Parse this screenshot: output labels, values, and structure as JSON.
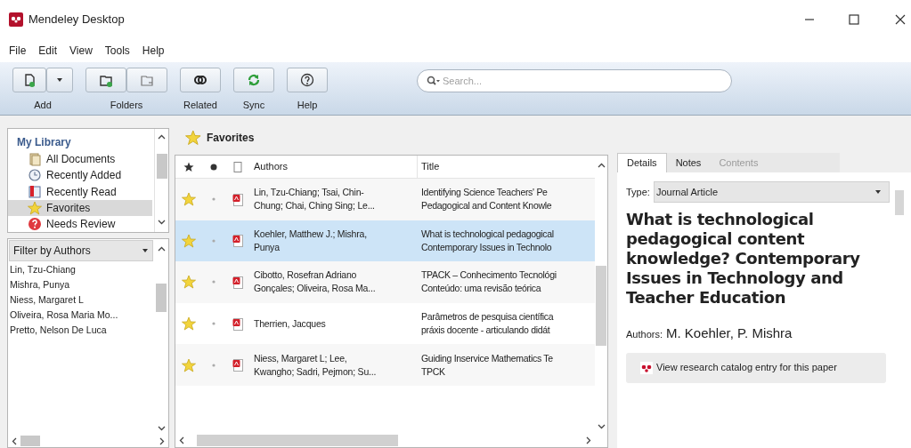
{
  "window": {
    "title": "Mendeley Desktop"
  },
  "menu": [
    "File",
    "Edit",
    "View",
    "Tools",
    "Help"
  ],
  "toolbar": [
    {
      "kind": "add",
      "label": "Add"
    },
    {
      "kind": "folders",
      "label": "Folders"
    },
    {
      "kind": "related",
      "label": "Related"
    },
    {
      "kind": "sync",
      "label": "Sync"
    },
    {
      "kind": "help",
      "label": "Help"
    }
  ],
  "search": {
    "placeholder": "Search..."
  },
  "sidebar": {
    "title": "My Library",
    "items": [
      {
        "kind": "all",
        "label": "All Documents",
        "selected": false
      },
      {
        "kind": "recent-added",
        "label": "Recently Added",
        "selected": false
      },
      {
        "kind": "recent-read",
        "label": "Recently Read",
        "selected": false
      },
      {
        "kind": "favorites",
        "label": "Favorites",
        "selected": true
      },
      {
        "kind": "review",
        "label": "Needs Review",
        "selected": false
      }
    ]
  },
  "filter": {
    "label": "Filter by Authors",
    "items": [
      "Lin, Tzu-Chiang",
      "Mishra, Punya",
      "Niess, Margaret L",
      "Oliveira, Rosa Maria Mo...",
      "Pretto, Nelson De Luca"
    ]
  },
  "list_title": "Favorites",
  "table": {
    "columns": [
      "Authors",
      "Title"
    ],
    "rows": [
      {
        "favorite": true,
        "selected": false,
        "authors": "Lin, Tzu-Chiang; Tsai, Chin-\nChung; Chai, Ching Sing; Le...",
        "title": "Identifying Science Teachers' Pe\nPedagogical and Content Knowle"
      },
      {
        "favorite": true,
        "selected": true,
        "authors": "Koehler, Matthew J.; Mishra,\nPunya",
        "title": "What is technological pedagogical\nContemporary Issues in Technolo"
      },
      {
        "favorite": true,
        "selected": false,
        "authors": "Cibotto, Rosefran Adriano\nGonçales; Oliveira, Rosa Ma...",
        "title": "TPACK – Conhecimento Tecnológi\nConteúdo: uma revisão teórica"
      },
      {
        "favorite": true,
        "selected": false,
        "authors": "Therrien, Jacques",
        "title": "Parâmetros de pesquisa científica\npráxis docente - articulando didát"
      },
      {
        "favorite": true,
        "selected": false,
        "authors": "Niess, Margaret L; Lee,\nKwangho; Sadri, Pejmon; Su...",
        "title": "Guiding Inservice Mathematics Te\nTPCK"
      }
    ]
  },
  "details": {
    "tabs": [
      {
        "label": "Details",
        "selected": true,
        "disabled": false
      },
      {
        "label": "Notes",
        "selected": false,
        "disabled": false
      },
      {
        "label": "Contents",
        "selected": false,
        "disabled": true
      }
    ],
    "type_label": "Type:",
    "type_value": "Journal Article",
    "title": "What is technological pedagogical content knowledge? Contemporary Issues in Technology and Teacher Education",
    "authors_label": "Authors:",
    "authors": "M. Koehler, P. Mishra",
    "catalog_button": "View research catalog entry for this paper"
  }
}
